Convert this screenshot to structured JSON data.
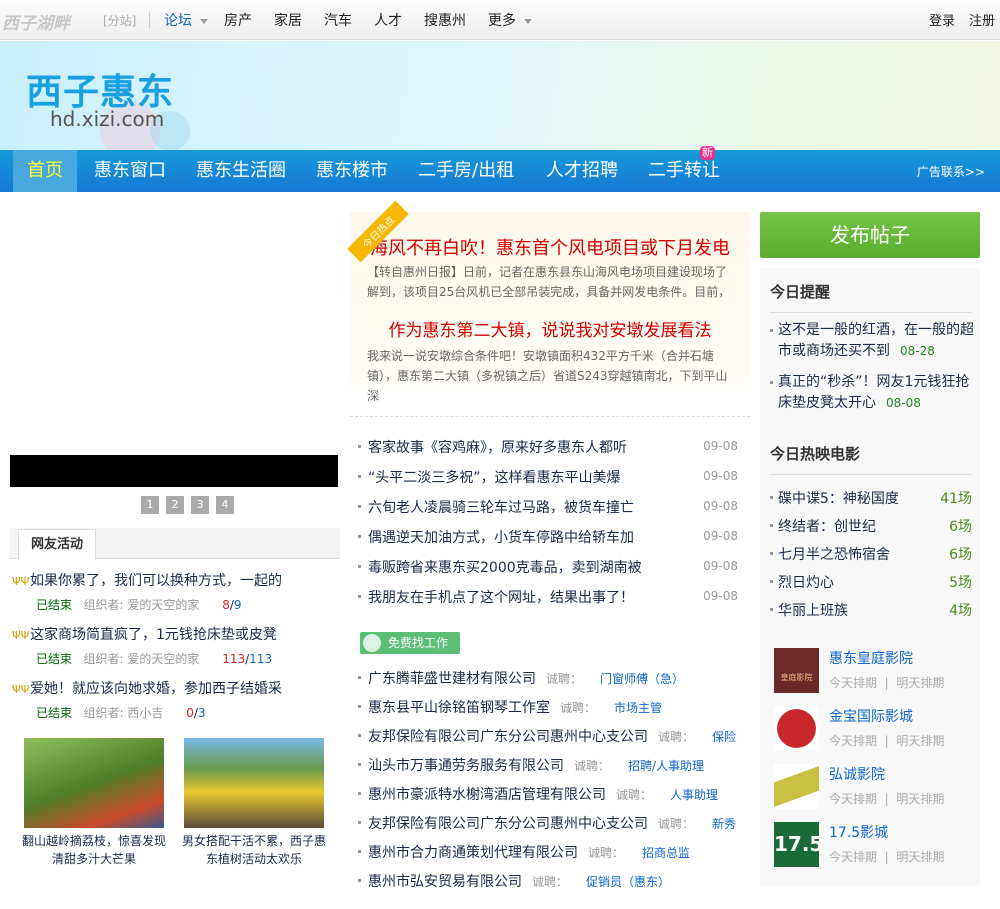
{
  "topbar": {
    "logo": "西子湖畔",
    "subsite": "[分站]",
    "nav": [
      "论坛",
      "房产",
      "家居",
      "汽车",
      "人才",
      "搜惠州",
      "更多"
    ],
    "login": "登录",
    "register": "注册"
  },
  "banner": {
    "brand": "西子惠东",
    "domain": "hd.xizi.com"
  },
  "nav": {
    "items": [
      "首页",
      "惠东窗口",
      "惠东生活圈",
      "惠东楼市",
      "二手房/出租",
      "人才招聘",
      "二手转让"
    ],
    "new_badge": "新",
    "ad_link": "广告联系>>"
  },
  "slider": {
    "dots": [
      "1",
      "2",
      "3",
      "4"
    ]
  },
  "activities": {
    "tab": "网友活动",
    "items": [
      {
        "title": "如果你累了，我们可以换种方式，一起的",
        "status": "已结束",
        "organizer": "组织者: 爱的天空的家",
        "joined": "8",
        "total": "9"
      },
      {
        "title": "这家商场简直疯了，1元钱抢床垫或皮凳",
        "status": "已结束",
        "organizer": "组织者: 爱的天空的家",
        "joined": "113",
        "total": "113"
      },
      {
        "title": "爱她！就应该向她求婚，参加西子结婚采",
        "status": "已结束",
        "organizer": "组织者: 西小吉",
        "joined": "0",
        "total": "3"
      }
    ],
    "photos": [
      {
        "caption": "翻山越岭摘荔枝，惊喜发现清甜多汁大芒果"
      },
      {
        "caption": "男女搭配干活不累，西子惠东植树活动太欢乐"
      }
    ]
  },
  "hot": {
    "ribbon": "今日热点",
    "stories": [
      {
        "headline": "海风不再白吹！惠东首个风电项目或下月发电",
        "summary": "【转自惠州日报】日前，记者在惠东县东山海风电场项目建设现场了解到，该项目25台风机已全部吊装完成，具备并网发电条件。目前，"
      },
      {
        "headline": "作为惠东第二大镇，说说我对安墩发展看法",
        "summary": "我来说一说安墩综合条件吧！安墩镇面积432平方千米（合并石塘镇），惠东第二大镇（多祝镇之后）省道S243穿越镇南北，下到平山深"
      }
    ]
  },
  "news": [
    {
      "title": "客家故事《容鸡麻》，原来好多惠东人都听",
      "date": "09-08"
    },
    {
      "title": "“头平二淡三多祝”，这样看惠东平山美爆",
      "date": "09-08"
    },
    {
      "title": "六旬老人凌晨骑三轮车过马路，被货车撞亡",
      "date": "09-08"
    },
    {
      "title": "偶遇逆天加油方式，小货车停路中给轿车加",
      "date": "09-08"
    },
    {
      "title": "毒贩跨省来惠东买2000克毒品，卖到湖南被",
      "date": "09-08"
    },
    {
      "title": "我朋友在手机点了这个网址，结果出事了！",
      "date": "09-08"
    }
  ],
  "jobs": {
    "button": "免费找工作",
    "label": "诚聘：",
    "items": [
      {
        "company": "广东腾菲盛世建材有限公司",
        "position": "门窗师傅（急）"
      },
      {
        "company": "惠东县平山徐铭笛钢琴工作室",
        "position": "市场主管"
      },
      {
        "company": "友邦保险有限公司广东分公司惠州中心支公司",
        "position": "保险"
      },
      {
        "company": "汕头市万事通劳务服务有限公司",
        "position": "招聘/人事助理"
      },
      {
        "company": "惠州市豪派特水榭湾酒店管理有限公司",
        "position": "人事助理"
      },
      {
        "company": "友邦保险有限公司广东分公司惠州中心支公司",
        "position": "新秀"
      },
      {
        "company": "惠州市合力商通策划代理有限公司",
        "position": "招商总监"
      },
      {
        "company": "惠州市弘安贸易有限公司",
        "position": "促销员（惠东）"
      }
    ]
  },
  "sidebar": {
    "publish": "发布帖子",
    "reminder_title": "今日提醒",
    "reminders": [
      {
        "text": "这不是一般的红酒，在一般的超市或商场还买不到",
        "date": "08-28"
      },
      {
        "text": "真正的“秒杀”！网友1元钱狂抢床垫皮凳太开心",
        "date": "08-08"
      }
    ],
    "movies_title": "今日热映电影",
    "movies": [
      {
        "name": "碟中谍5：神秘国度",
        "count": "41场"
      },
      {
        "name": "终结者：创世纪",
        "count": "6场"
      },
      {
        "name": "七月半之恐怖宿舍",
        "count": "6场"
      },
      {
        "name": "烈日灼心",
        "count": "5场"
      },
      {
        "name": "华丽上班族",
        "count": "4场"
      }
    ],
    "cinemas": [
      {
        "name": "惠东皇庭影院",
        "logo_text": "皇庭影院"
      },
      {
        "name": "金宝国际影城"
      },
      {
        "name": "弘诚影院"
      },
      {
        "name": "17.5影城",
        "logo_text": "17.5"
      }
    ],
    "today": "今天排期",
    "tomorrow": "明天排期",
    "sep": "|"
  }
}
